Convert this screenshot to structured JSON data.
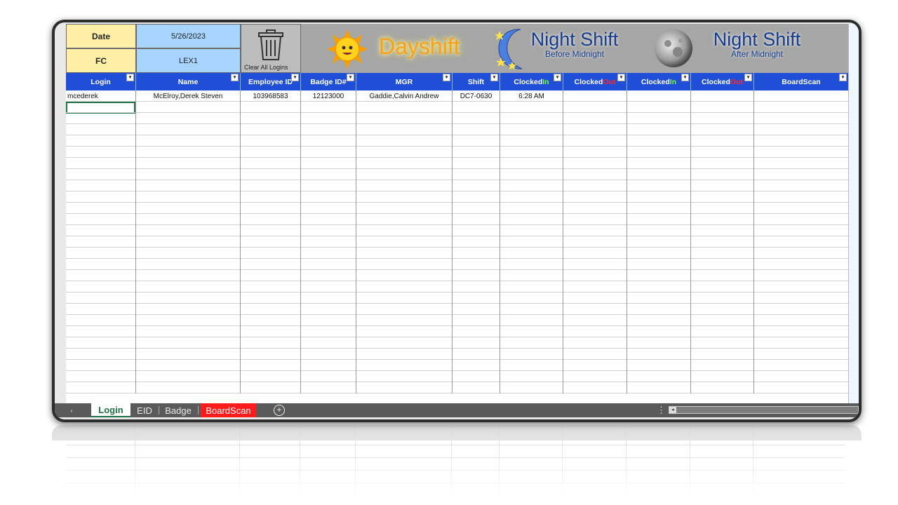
{
  "header": {
    "date_label": "Date",
    "date_value": "5/26/2023",
    "fc_label": "FC",
    "fc_value": "LEX1",
    "clear_label": "Clear All Logins",
    "dayshift_label": "Dayshift",
    "night_before_title": "Night Shift",
    "night_before_sub": "Before Midnight",
    "night_after_title": "Night Shift",
    "night_after_sub": "After Midnight"
  },
  "table": {
    "columns": [
      {
        "label": "Login"
      },
      {
        "label": "Name"
      },
      {
        "label": "Employee ID"
      },
      {
        "label": "Badge ID#"
      },
      {
        "label": "MGR"
      },
      {
        "label": "Shift"
      },
      {
        "label_a": "Clocked ",
        "label_b": "In",
        "b_color": "#7dff2a"
      },
      {
        "label_a": "Clocked ",
        "label_b": "Out",
        "b_color": "#ff2a2a"
      },
      {
        "label_a": "Clocked ",
        "label_b": "In",
        "b_color": "#7dff2a"
      },
      {
        "label_a": "Clocked ",
        "label_b": "Out",
        "b_color": "#ff2a2a"
      },
      {
        "label": "BoardScan"
      }
    ],
    "rows": [
      [
        "mcederek",
        "McElroy,Derek Steven",
        "103968583",
        "12123000",
        "Gaddie,Calvin Andrew",
        "DC7-0630",
        "6:28 AM",
        "",
        "",
        "",
        ""
      ]
    ]
  },
  "sheet_tabs": {
    "login": "Login",
    "eid": "EID",
    "badge": "Badge",
    "boardscan": "BoardScan"
  },
  "colors": {
    "header_blue": "#1f4fd7",
    "label_yellow": "#fdf0a6",
    "value_blue": "#a8d5ff",
    "boardscan_tab_red": "#ff1b1b",
    "active_tab_green": "#1e7145"
  }
}
